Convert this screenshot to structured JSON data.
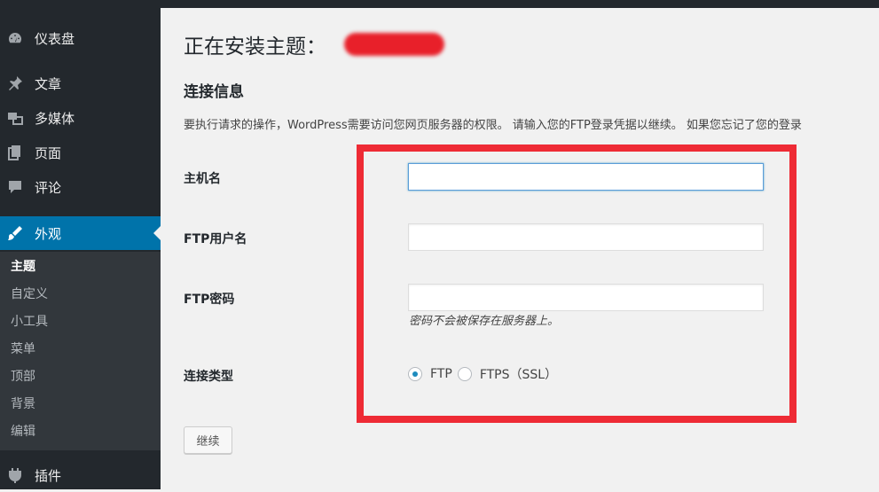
{
  "sidebar": {
    "menu": [
      {
        "label": "仪表盘",
        "icon": "dashboard-icon"
      },
      {
        "label": "文章",
        "icon": "pin-icon"
      },
      {
        "label": "多媒体",
        "icon": "media-icon"
      },
      {
        "label": "页面",
        "icon": "page-icon"
      },
      {
        "label": "评论",
        "icon": "comment-icon"
      },
      {
        "label": "外观",
        "icon": "brush-icon"
      }
    ],
    "submenu": [
      "主题",
      "自定义",
      "小工具",
      "菜单",
      "顶部",
      "背景",
      "编辑"
    ],
    "plugins": {
      "label": "插件",
      "icon": "plugin-icon"
    }
  },
  "main": {
    "title": "正在安装主题：",
    "section_title": "连接信息",
    "description": "要执行请求的操作，WordPress需要访问您网页服务器的权限。 请输入您的FTP登录凭据以继续。 如果您忘记了您的登录",
    "fields": {
      "hostname": {
        "label": "主机名",
        "value": ""
      },
      "username": {
        "label": "FTP用户名",
        "value": ""
      },
      "password": {
        "label": "FTP密码",
        "value": "",
        "hint": "密码不会被保存在服务器上。"
      },
      "connection_type": {
        "label": "连接类型",
        "options": [
          "FTP",
          "FTPS（SSL）"
        ],
        "selected": "FTP"
      }
    },
    "continue_label": "继续"
  },
  "colors": {
    "sidebar": "#23282d",
    "active": "#0073aa",
    "highlight": "#ee2b35"
  }
}
